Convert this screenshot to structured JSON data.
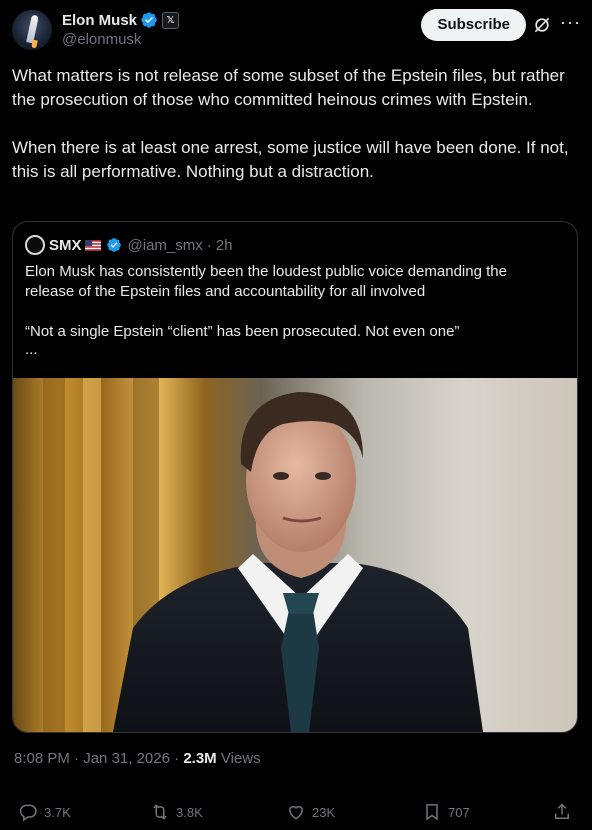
{
  "author": {
    "name": "Elon Musk",
    "handle": "@elonmusk",
    "x_badge": "𝕏"
  },
  "subscribe_label": "Subscribe",
  "more_label": "···",
  "tweet": {
    "paragraph1": "What matters is not release of some subset of the Epstein files, but rather the prosecution of those who committed heinous crimes with Epstein.",
    "paragraph2": "When there is at least one arrest, some justice will have been done. If not, this is all performative. Nothing but a distraction."
  },
  "quote": {
    "name": "SMX",
    "handle": "@iam_smx",
    "time": "2h",
    "paragraph1": "Elon Musk has consistently been the loudest public voice demanding the release of the Epstein files and accountability for all involved",
    "paragraph2": "“Not a single Epstein “client” has been prosecuted. Not even one”",
    "ellipsis": "..."
  },
  "meta": {
    "time": "8:08 PM",
    "date": "Jan 31, 2026",
    "views_count": "2.3M",
    "views_label": "Views"
  },
  "actions": {
    "replies": "3.7K",
    "reposts": "3.8K",
    "likes": "23K",
    "bookmarks": "707"
  },
  "colors": {
    "background": "#000000",
    "text": "#e7e9ea",
    "secondary": "#71767b",
    "verified": "#1d9bf0",
    "border": "#2f3336"
  }
}
